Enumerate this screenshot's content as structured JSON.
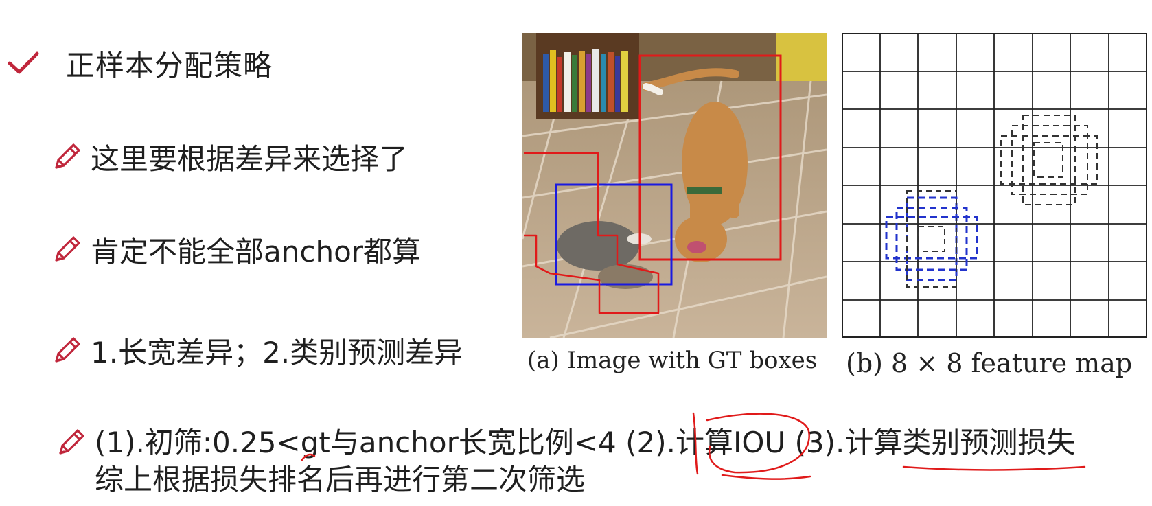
{
  "heading": {
    "text": "正样本分配策略",
    "icon": "check-icon"
  },
  "bullets": [
    {
      "text": "这里要根据差异来选择了",
      "icon": "pencil-icon"
    },
    {
      "text": "肯定不能全部anchor都算",
      "icon": "pencil-icon"
    },
    {
      "text": "1.长宽差异；2.类别预测差异",
      "icon": "pencil-icon"
    }
  ],
  "bottom": {
    "line1": "(1).初筛:0.25<gt与anchor长宽比例<4 (2).计算IOU (3).计算类别预测损失",
    "line2": "综上根据损失排名后再进行第二次筛选",
    "icon": "pencil-icon"
  },
  "figure": {
    "caption_a": "(a) Image with GT boxes",
    "caption_b": "(b) 8 × 8 feature map"
  },
  "colors": {
    "check": "#c0263b",
    "pencil": "#c0263b",
    "gt_box_dog": "#e01a1a",
    "gt_box_cat": "#1a1ae0",
    "annotation": "#e01a1a",
    "grid_line": "#222222"
  }
}
